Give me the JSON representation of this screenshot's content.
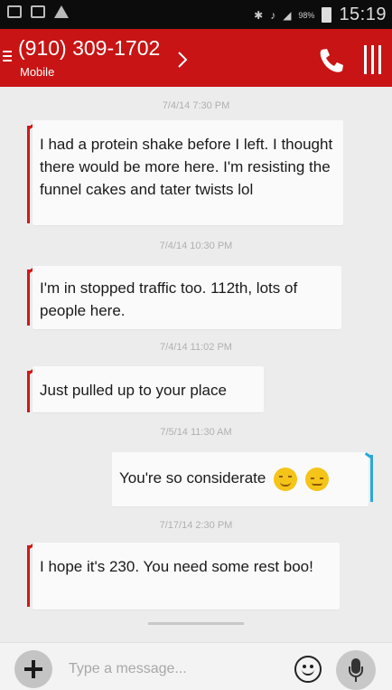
{
  "status_bar": {
    "time": "15:19",
    "battery": "98%",
    "icons": [
      "image-icon",
      "sim-icon",
      "warning-icon",
      "bluetooth-icon",
      "mute-icon",
      "signal-icon",
      "battery-icon"
    ]
  },
  "header": {
    "phone_number": "(910) 309-1702",
    "number_type": "Mobile",
    "icons": [
      "menu-icon",
      "chevron-right-icon",
      "phone-icon",
      "more-icon"
    ]
  },
  "thread": {
    "timestamps": [
      "7/4/14 7:30 PM",
      "7/4/14 10:30 PM",
      "7/4/14 11:02 PM",
      "7/5/14 11:30 AM",
      "7/17/14 2:30 PM"
    ],
    "messages": [
      {
        "direction": "incoming",
        "text": "I had a protein shake before I left. I thought there would be more here. I'm resisting the funnel cakes and tater twists lol"
      },
      {
        "direction": "incoming",
        "text": "I'm in stopped traffic too. 112th, lots of people here."
      },
      {
        "direction": "incoming",
        "text": "Just pulled up to your place"
      },
      {
        "direction": "outgoing",
        "text": "You're so considerate",
        "emojis": [
          "smiling-face-icon",
          "relieved-face-icon"
        ]
      },
      {
        "direction": "incoming",
        "text": "I hope it's 230. You need some rest boo!"
      }
    ]
  },
  "composer": {
    "placeholder": "Type a message...",
    "value": "",
    "icons": [
      "plus-icon",
      "emoji-icon",
      "microphone-icon"
    ]
  },
  "colors": {
    "header": "#c81414",
    "incoming_accent": "#d01818",
    "outgoing_accent": "#29a9d8",
    "background": "#ececec"
  }
}
